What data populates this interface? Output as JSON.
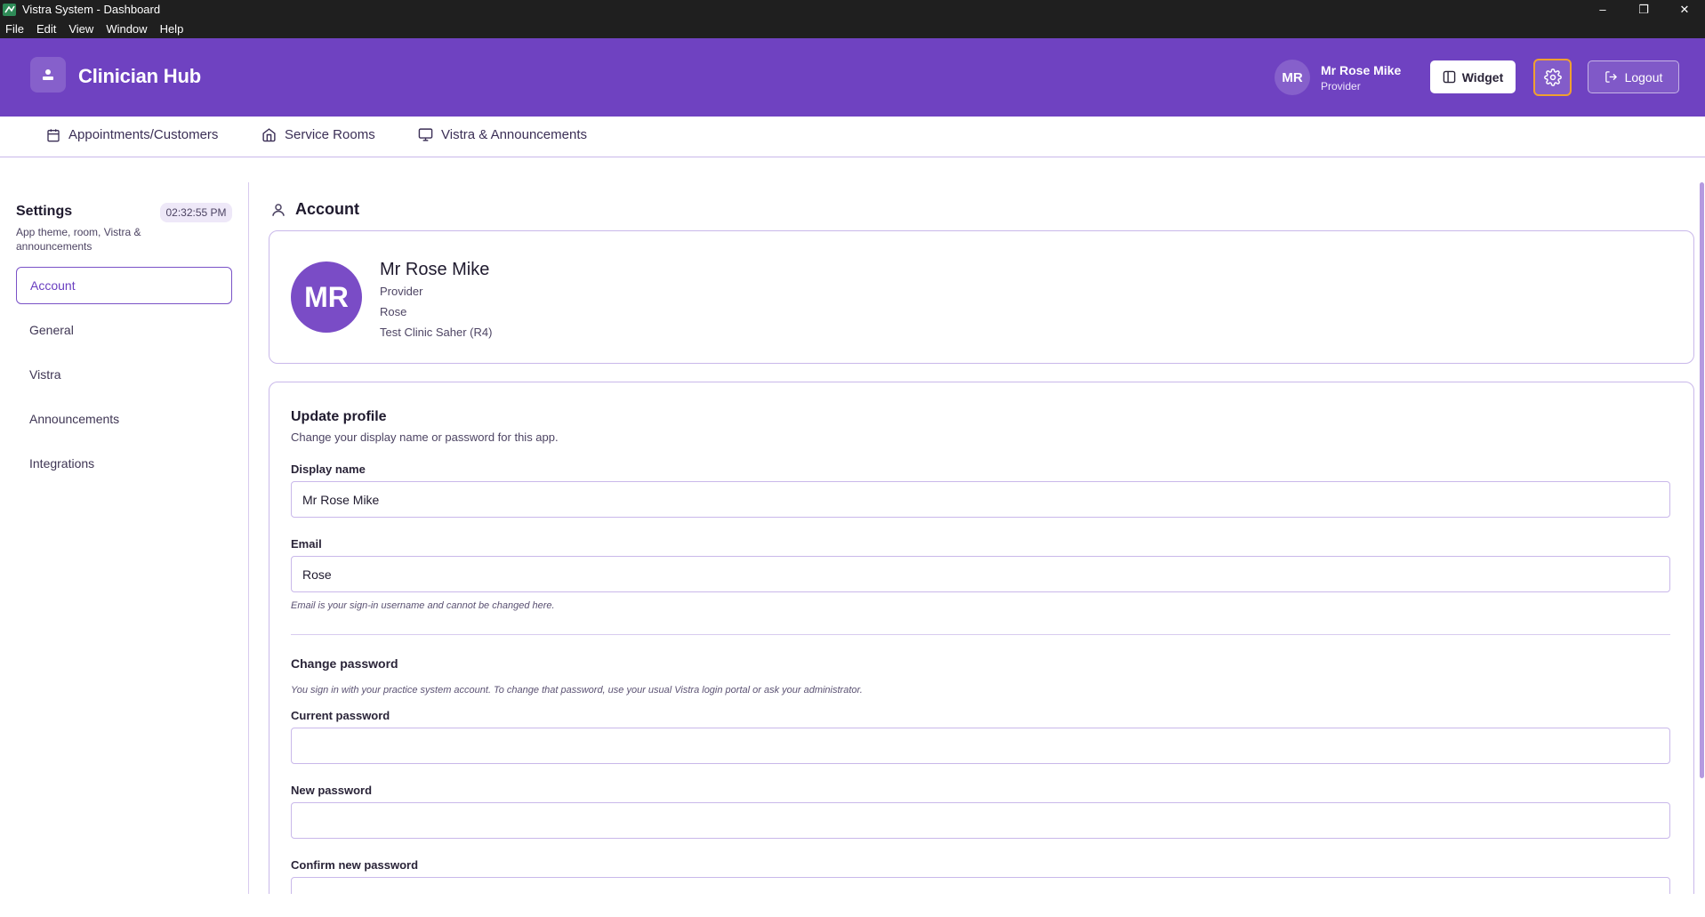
{
  "window": {
    "title": "Vistra System - Dashboard",
    "menu": [
      "File",
      "Edit",
      "View",
      "Window",
      "Help"
    ],
    "controls": [
      "–",
      "❐",
      "✕"
    ]
  },
  "header": {
    "brand": "Clinician Hub",
    "user_initials": "MR",
    "user_name": "Mr Rose Mike",
    "user_role": "Provider",
    "widget_label": "Widget",
    "logout_label": "Logout",
    "accent_color": "#6f42c1",
    "settings_highlight_color": "#f0a030"
  },
  "tabs": [
    {
      "label": "Appointments/Customers",
      "icon": "calendar-icon"
    },
    {
      "label": "Service Rooms",
      "icon": "home-icon"
    },
    {
      "label": "Vistra & Announcements",
      "icon": "monitor-icon"
    }
  ],
  "sidebar": {
    "title": "Settings",
    "clock": "02:32:55 PM",
    "subtitle": "App theme, room, Vistra & announcements",
    "items": [
      {
        "label": "Account",
        "active": true
      },
      {
        "label": "General",
        "active": false
      },
      {
        "label": "Vistra",
        "active": false
      },
      {
        "label": "Announcements",
        "active": false
      },
      {
        "label": "Integrations",
        "active": false
      }
    ]
  },
  "account": {
    "section_title": "Account",
    "initials": "MR",
    "name": "Mr Rose Mike",
    "role": "Provider",
    "username": "Rose",
    "clinic": "Test Clinic Saher (R4)"
  },
  "update_profile": {
    "title": "Update profile",
    "subtitle": "Change your display name or password for this app.",
    "display_name_label": "Display name",
    "display_name_value": "Mr Rose Mike",
    "email_label": "Email",
    "email_value": "Rose",
    "email_hint": "Email is your sign-in username and cannot be changed here.",
    "change_password_title": "Change password",
    "change_password_hint": "You sign in with your practice system account. To change that password, use your usual Vistra login portal or ask your administrator.",
    "current_password_label": "Current password",
    "new_password_label": "New password",
    "confirm_password_label": "Confirm new password"
  }
}
